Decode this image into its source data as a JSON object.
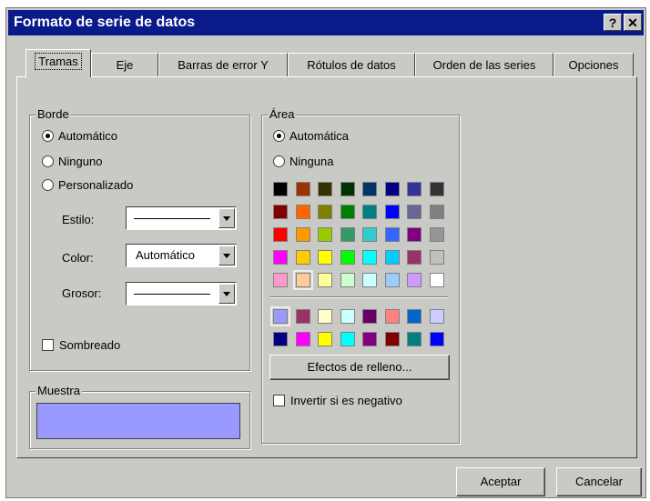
{
  "window": {
    "title": "Formato de serie de datos",
    "help_label": "?",
    "close_label": "✕"
  },
  "tabs": [
    "Tramas",
    "Eje",
    "Barras de error Y",
    "Rótulos de datos",
    "Orden de las series",
    "Opciones"
  ],
  "borde": {
    "legend": "Borde",
    "automatico": "Automático",
    "ninguno": "Ninguno",
    "personalizado": "Personalizado",
    "estilo_label": "Estilo:",
    "color_label": "Color:",
    "color_value": "Automático",
    "grosor_label": "Grosor:",
    "sombreado": "Sombreado"
  },
  "muestra": {
    "legend": "Muestra",
    "preview_color": "#9999ff"
  },
  "area": {
    "legend": "Área",
    "automatica": "Automática",
    "ninguna": "Ninguna",
    "palette": [
      [
        "#000000",
        "#993300",
        "#333300",
        "#003300",
        "#003366",
        "#000080",
        "#333399",
        "#333333"
      ],
      [
        "#800000",
        "#ff6600",
        "#808000",
        "#008000",
        "#008080",
        "#0000ff",
        "#666699",
        "#808080"
      ],
      [
        "#ff0000",
        "#ff9900",
        "#99cc00",
        "#339966",
        "#33cccc",
        "#3366ff",
        "#800080",
        "#969696"
      ],
      [
        "#ff00ff",
        "#ffcc00",
        "#ffff00",
        "#00ff00",
        "#00ffff",
        "#00ccff",
        "#993366",
        "#c0c0c0"
      ],
      [
        "#ff99cc",
        "#ffcc99",
        "#ffff99",
        "#ccffcc",
        "#ccffff",
        "#99ccff",
        "#cc99ff",
        "#ffffff"
      ]
    ],
    "extra_palette": [
      [
        "#9999ff",
        "#993366",
        "#ffffcc",
        "#ccffff",
        "#660066",
        "#ff8080",
        "#0066cc",
        "#ccccff"
      ],
      [
        "#000080",
        "#ff00ff",
        "#ffff00",
        "#00ffff",
        "#800080",
        "#800000",
        "#008080",
        "#0000ff"
      ]
    ],
    "efectos_button": "Efectos de relleno...",
    "invertir": "Invertir si es negativo"
  },
  "footer": {
    "aceptar": "Aceptar",
    "cancelar": "Cancelar"
  }
}
